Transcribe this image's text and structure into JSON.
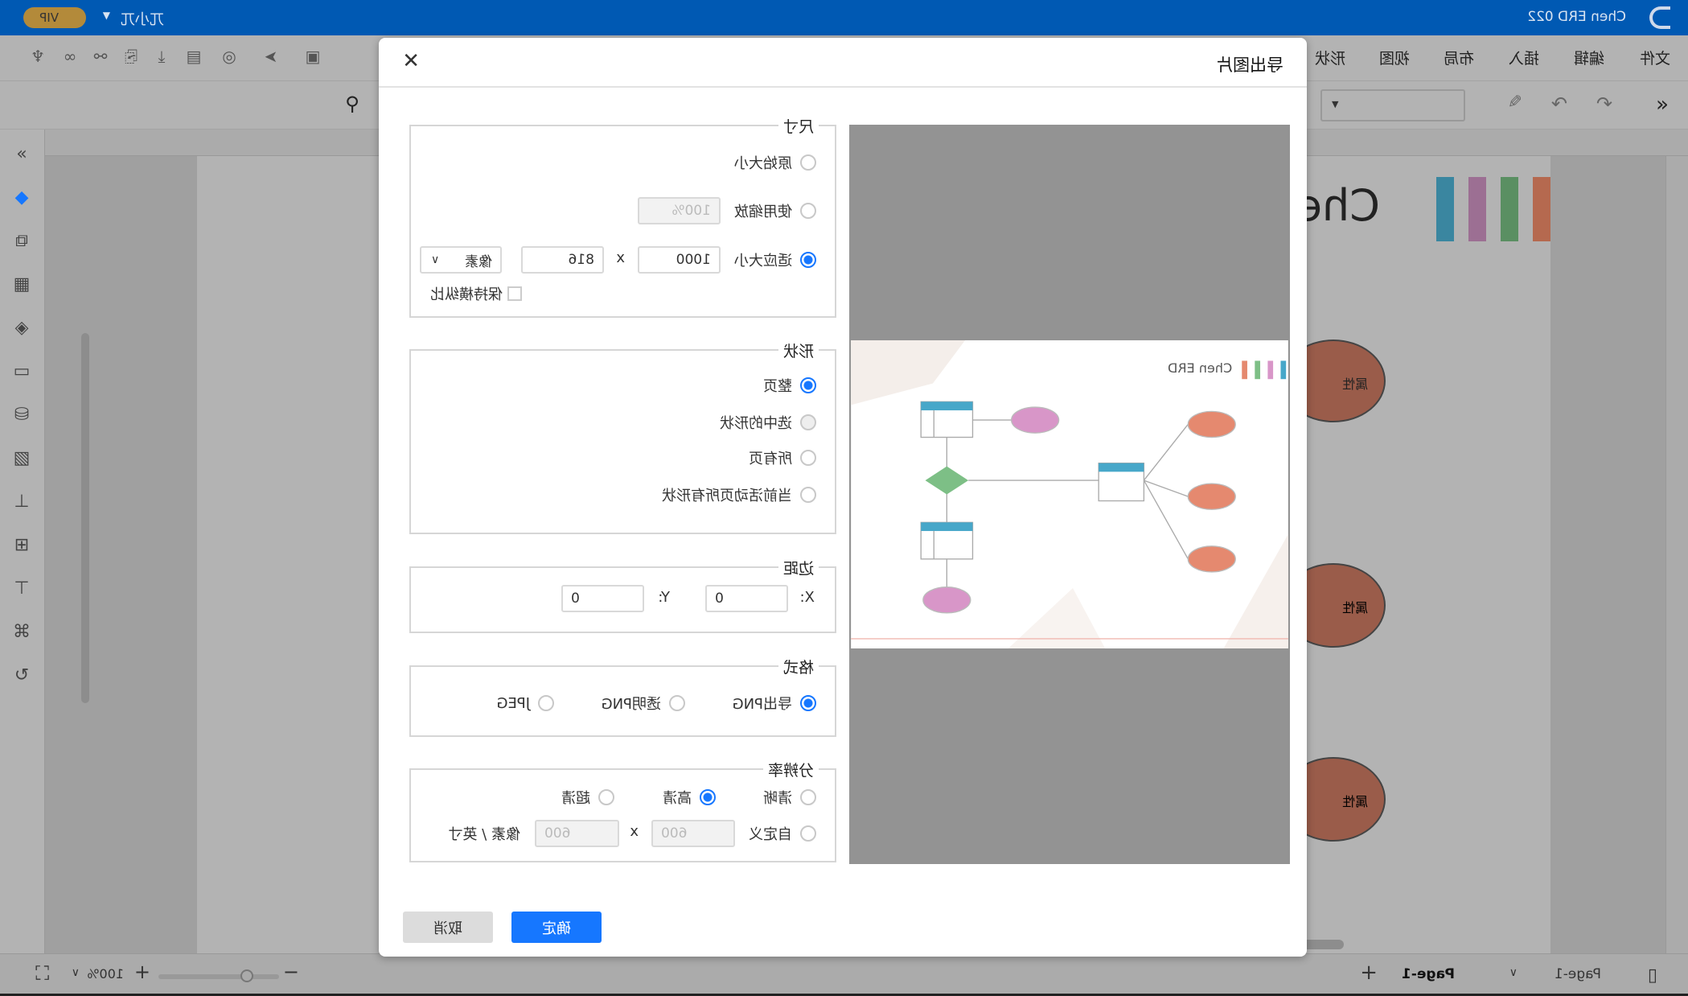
{
  "app": {
    "doc_title": "Chen ERD 022",
    "user": "兀小兀",
    "vip": "VIP"
  },
  "menu": [
    "文件",
    "编辑",
    "插入",
    "布局",
    "视图",
    "形状"
  ],
  "bottom": {
    "page_selector": "Page-1",
    "active_tab": "Page-1",
    "zoom": "100%"
  },
  "canvas": {
    "title_fragment": "Che",
    "attr_label": "属性"
  },
  "dialog": {
    "title": "导出图片",
    "size": {
      "legend": "尺寸",
      "original": "原始大小",
      "use_scale": "使用缩放",
      "scale_value": "100%",
      "fit": "适应大小",
      "width": "1000",
      "x": "x",
      "height": "816",
      "unit": "像素",
      "keep_ratio": "保持横纵比",
      "selected": "适应大小"
    },
    "shape": {
      "legend": "形状",
      "options": [
        "整页",
        "选中的形状",
        "所有页",
        "当前活动页所有形状"
      ],
      "selected": "整页"
    },
    "margin": {
      "legend": "边距",
      "x_label": "X:",
      "x_value": "0",
      "y_label": "Y:",
      "y_value": "0"
    },
    "format": {
      "legend": "格式",
      "options": [
        "导出PNG",
        "透明PNG",
        "JPEG"
      ],
      "selected": "导出PNG"
    },
    "resolution": {
      "legend": "分辨率",
      "options": [
        "清晰",
        "高清",
        "超清"
      ],
      "selected": "高清",
      "custom": "自定义",
      "dpi_x": "600",
      "x": "x",
      "dpi_y": "600",
      "unit": "像素 / 英寸"
    },
    "preview": {
      "title": "Chen ERD",
      "bar_colors": [
        "#e5896f",
        "#7dbf86",
        "#d896c8",
        "#47a7c9"
      ]
    },
    "ok": "确定",
    "cancel": "取消"
  },
  "colors": {
    "accent": "#1677ff",
    "titlebar": "#0059b3"
  }
}
